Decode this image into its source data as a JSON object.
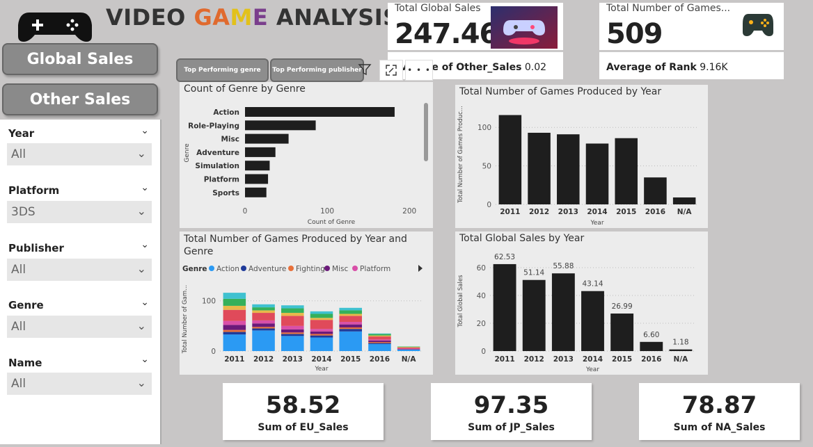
{
  "header": {
    "title_part1": "VIDEO ",
    "title_g": "G",
    "title_a": "A",
    "title_m": "M",
    "title_e": "E",
    "title_part2": " ANALYSIS",
    "logo_icon": "gamepad-icon"
  },
  "nav": {
    "global_sales": "Global Sales",
    "other_sales": "Other Sales"
  },
  "slicers": [
    {
      "label": "Year",
      "value": "All"
    },
    {
      "label": "Platform",
      "value": "3DS"
    },
    {
      "label": "Publisher",
      "value": "All"
    },
    {
      "label": "Genre",
      "value": "All"
    },
    {
      "label": "Name",
      "value": "All"
    }
  ],
  "kpis": {
    "global_sales_label": "Total Global Sales",
    "global_sales_value": "247.46",
    "other_sales_label": "Average of Other_Sales",
    "other_sales_value": "0.02",
    "games_label": "Total Number of Games...",
    "games_value": "509",
    "rank_label": "Average of Rank",
    "rank_value": "9.16K"
  },
  "buttons": {
    "top_genre": "Top Performing genre",
    "top_publisher": "Top Performing publisher",
    "more": "• • •"
  },
  "sums": [
    {
      "value": "58.52",
      "label": "Sum of EU_Sales"
    },
    {
      "value": "97.35",
      "label": "Sum of JP_Sales"
    },
    {
      "value": "78.87",
      "label": "Sum of NA_Sales"
    }
  ],
  "chart_data": [
    {
      "type": "bar",
      "orientation": "horizontal",
      "title": "Count of Genre by Genre",
      "xlabel": "Count of Genre",
      "ylabel": "Genre",
      "categories": [
        "Action",
        "Role-Playing",
        "Misc",
        "Adventure",
        "Simulation",
        "Platform",
        "Sports"
      ],
      "values": [
        182,
        86,
        53,
        37,
        30,
        28,
        26
      ],
      "xlim": [
        0,
        210
      ],
      "ticks": [
        "0",
        "100",
        "200"
      ],
      "color": "#1e1e1e"
    },
    {
      "type": "bar",
      "title": "Total Number of Games Produced by Year",
      "xlabel": "Year",
      "ylabel": "Total Number of Games Produc...",
      "categories": [
        "2011",
        "2012",
        "2013",
        "2014",
        "2015",
        "2016",
        "N/A"
      ],
      "values": [
        116,
        93,
        91,
        79,
        86,
        35,
        9
      ],
      "ylim": [
        0,
        130
      ],
      "ticks": [
        "0",
        "50",
        "100"
      ],
      "color": "#1e1e1e"
    },
    {
      "type": "bar",
      "stacked": true,
      "title": "Total Number of Games Produced by Year and Genre",
      "xlabel": "Year",
      "ylabel": "Total Number of Gam...",
      "legend_title": "Genre",
      "legend": [
        {
          "name": "Action",
          "color": "#2b9af3"
        },
        {
          "name": "Adventure",
          "color": "#1f3b99"
        },
        {
          "name": "Fighting",
          "color": "#e8703a"
        },
        {
          "name": "Misc",
          "color": "#6b1a7a"
        },
        {
          "name": "Platform",
          "color": "#d94fa8"
        }
      ],
      "categories": [
        "2011",
        "2012",
        "2013",
        "2014",
        "2015",
        "2016",
        "N/A"
      ],
      "series": [
        {
          "name": "Action",
          "color": "#2b9af3",
          "values": [
            33,
            41,
            30,
            27,
            39,
            14,
            3
          ]
        },
        {
          "name": "Adventure",
          "color": "#1f3b99",
          "values": [
            5,
            4,
            4,
            4,
            5,
            2,
            0
          ]
        },
        {
          "name": "Fighting",
          "color": "#e8703a",
          "values": [
            4,
            3,
            3,
            3,
            3,
            2,
            0
          ]
        },
        {
          "name": "Misc",
          "color": "#6b1a7a",
          "values": [
            10,
            7,
            6,
            5,
            6,
            3,
            1
          ]
        },
        {
          "name": "Platform",
          "color": "#d94fa8",
          "values": [
            8,
            6,
            7,
            5,
            5,
            2,
            1
          ]
        },
        {
          "name": "",
          "color": "#e04a5a",
          "values": [
            22,
            15,
            20,
            18,
            12,
            6,
            2
          ]
        },
        {
          "name": "",
          "color": "#e8b84a",
          "values": [
            8,
            5,
            6,
            4,
            4,
            2,
            1
          ]
        },
        {
          "name": "",
          "color": "#35b05a",
          "values": [
            14,
            6,
            9,
            8,
            7,
            3,
            1
          ]
        },
        {
          "name": "",
          "color": "#3fc1d0",
          "values": [
            12,
            6,
            6,
            5,
            5,
            1,
            0
          ]
        }
      ],
      "ylim": [
        0,
        130
      ],
      "ticks": [
        "0",
        "100"
      ]
    },
    {
      "type": "bar",
      "title": "Total Global Sales by Year",
      "xlabel": "Year",
      "ylabel": "Total Global Sales",
      "categories": [
        "2011",
        "2012",
        "2013",
        "2014",
        "2015",
        "2016",
        "N/A"
      ],
      "values": [
        62.53,
        51.14,
        55.88,
        43.14,
        26.99,
        6.6,
        1.18
      ],
      "labels": [
        "62.53",
        "51.14",
        "55.88",
        "43.14",
        "26.99",
        "6.60",
        "1.18"
      ],
      "ylim": [
        0,
        70
      ],
      "ticks": [
        "0",
        "20",
        "40",
        "60"
      ],
      "color": "#1e1e1e"
    }
  ]
}
